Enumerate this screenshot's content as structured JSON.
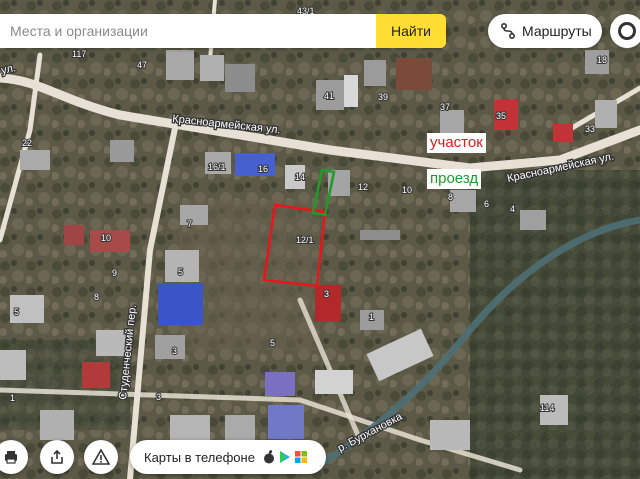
{
  "search": {
    "placeholder": "Места и организации",
    "button_label": "Найти"
  },
  "routes": {
    "label": "Маршруты"
  },
  "promo": {
    "label": "Карты в телефоне"
  },
  "annotations": {
    "plot_label": "участок",
    "passage_label": "проезд"
  },
  "streets": [
    {
      "id": "krasnoarmeiskaya-1",
      "name": "Красноармейская ул."
    },
    {
      "id": "krasnoarmeiskaya-2",
      "name": "Красноармейская ул."
    },
    {
      "id": "studencheskiy",
      "name": "Студенческий пер."
    },
    {
      "id": "ul-left",
      "name": "ул."
    },
    {
      "id": "river",
      "name": "р. Бурхановка"
    }
  ],
  "house_numbers": [
    "117",
    "47",
    "43/1",
    "41",
    "39",
    "37",
    "35",
    "33",
    "18",
    "22",
    "16/1",
    "16",
    "14",
    "12",
    "10",
    "8",
    "6",
    "4",
    "7",
    "12/1",
    "10",
    "5",
    "9",
    "8",
    "3",
    "1",
    "5",
    "3",
    "5",
    "114",
    "3",
    "1"
  ],
  "colors": {
    "plot_outline": "#e8161b",
    "passage_outline": "#1c9c2a",
    "search_button": "#ffdd33",
    "road": "#e6e1d4"
  }
}
